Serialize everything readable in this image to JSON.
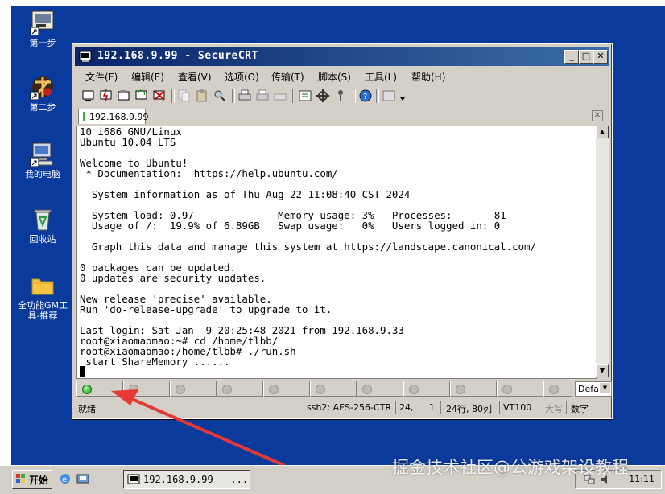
{
  "desktop": {
    "icons": [
      {
        "label": "第一步",
        "icon": "shortcut-app-icon"
      },
      {
        "label": "第二步",
        "icon": "game-logo-icon"
      },
      {
        "label": "我的电脑",
        "icon": "my-computer-icon"
      },
      {
        "label": "回收站",
        "icon": "recycle-bin-icon"
      },
      {
        "label": "全功能GM工具-推荐",
        "icon": "folder-icon"
      }
    ]
  },
  "window": {
    "title": "192.168.9.99 - SecureCRT",
    "menu": [
      "文件(F)",
      "编辑(E)",
      "查看(V)",
      "选项(O)",
      "传输(T)",
      "脚本(S)",
      "工具(L)",
      "帮助(H)"
    ],
    "tab_label": "192.168.9.99"
  },
  "terminal": {
    "lines": [
      "10 i686 GNU/Linux",
      "Ubuntu 10.04 LTS",
      "",
      "Welcome to Ubuntu!",
      " * Documentation:  https://help.ubuntu.com/",
      "",
      "  System information as of Thu Aug 22 11:08:40 CST 2024",
      "",
      "  System load: 0.97              Memory usage: 3%   Processes:       81",
      "  Usage of /:  19.9% of 6.89GB   Swap usage:   0%   Users logged in: 0",
      "",
      "  Graph this data and manage this system at https://landscape.canonical.com/",
      "",
      "0 packages can be updated.",
      "0 updates are security updates.",
      "",
      "New release 'precise' available.",
      "Run 'do-release-upgrade' to upgrade to it.",
      "",
      "Last login: Sat Jan  9 20:25:48 2021 from 192.168.9.33",
      "root@xiaomaomao:~# cd /home/tlbb/",
      "root@xiaomaomao:/home/tlbb# ./run.sh",
      " start ShareMemory ......"
    ]
  },
  "session_bar": {
    "first_slot_label": "一",
    "dropdown_value": "Defa"
  },
  "status": {
    "ready": "就绪",
    "protocol": "ssh2: AES-256-CTR",
    "row": "24,",
    "col": "1",
    "size": "24行, 80列",
    "term": "VT100",
    "caps": "大写",
    "num": "数字"
  },
  "taskbar": {
    "start_label": "开始",
    "app_label": "192.168.9.99 - ...",
    "clock": "11:11"
  },
  "watermark": "掘金技术社区@公游戏架设教程",
  "colors": {
    "desktop": "#0a3a9c",
    "titlebar": "#0a246a",
    "arrow": "#e53935",
    "led_on": "#1a9a1a"
  }
}
